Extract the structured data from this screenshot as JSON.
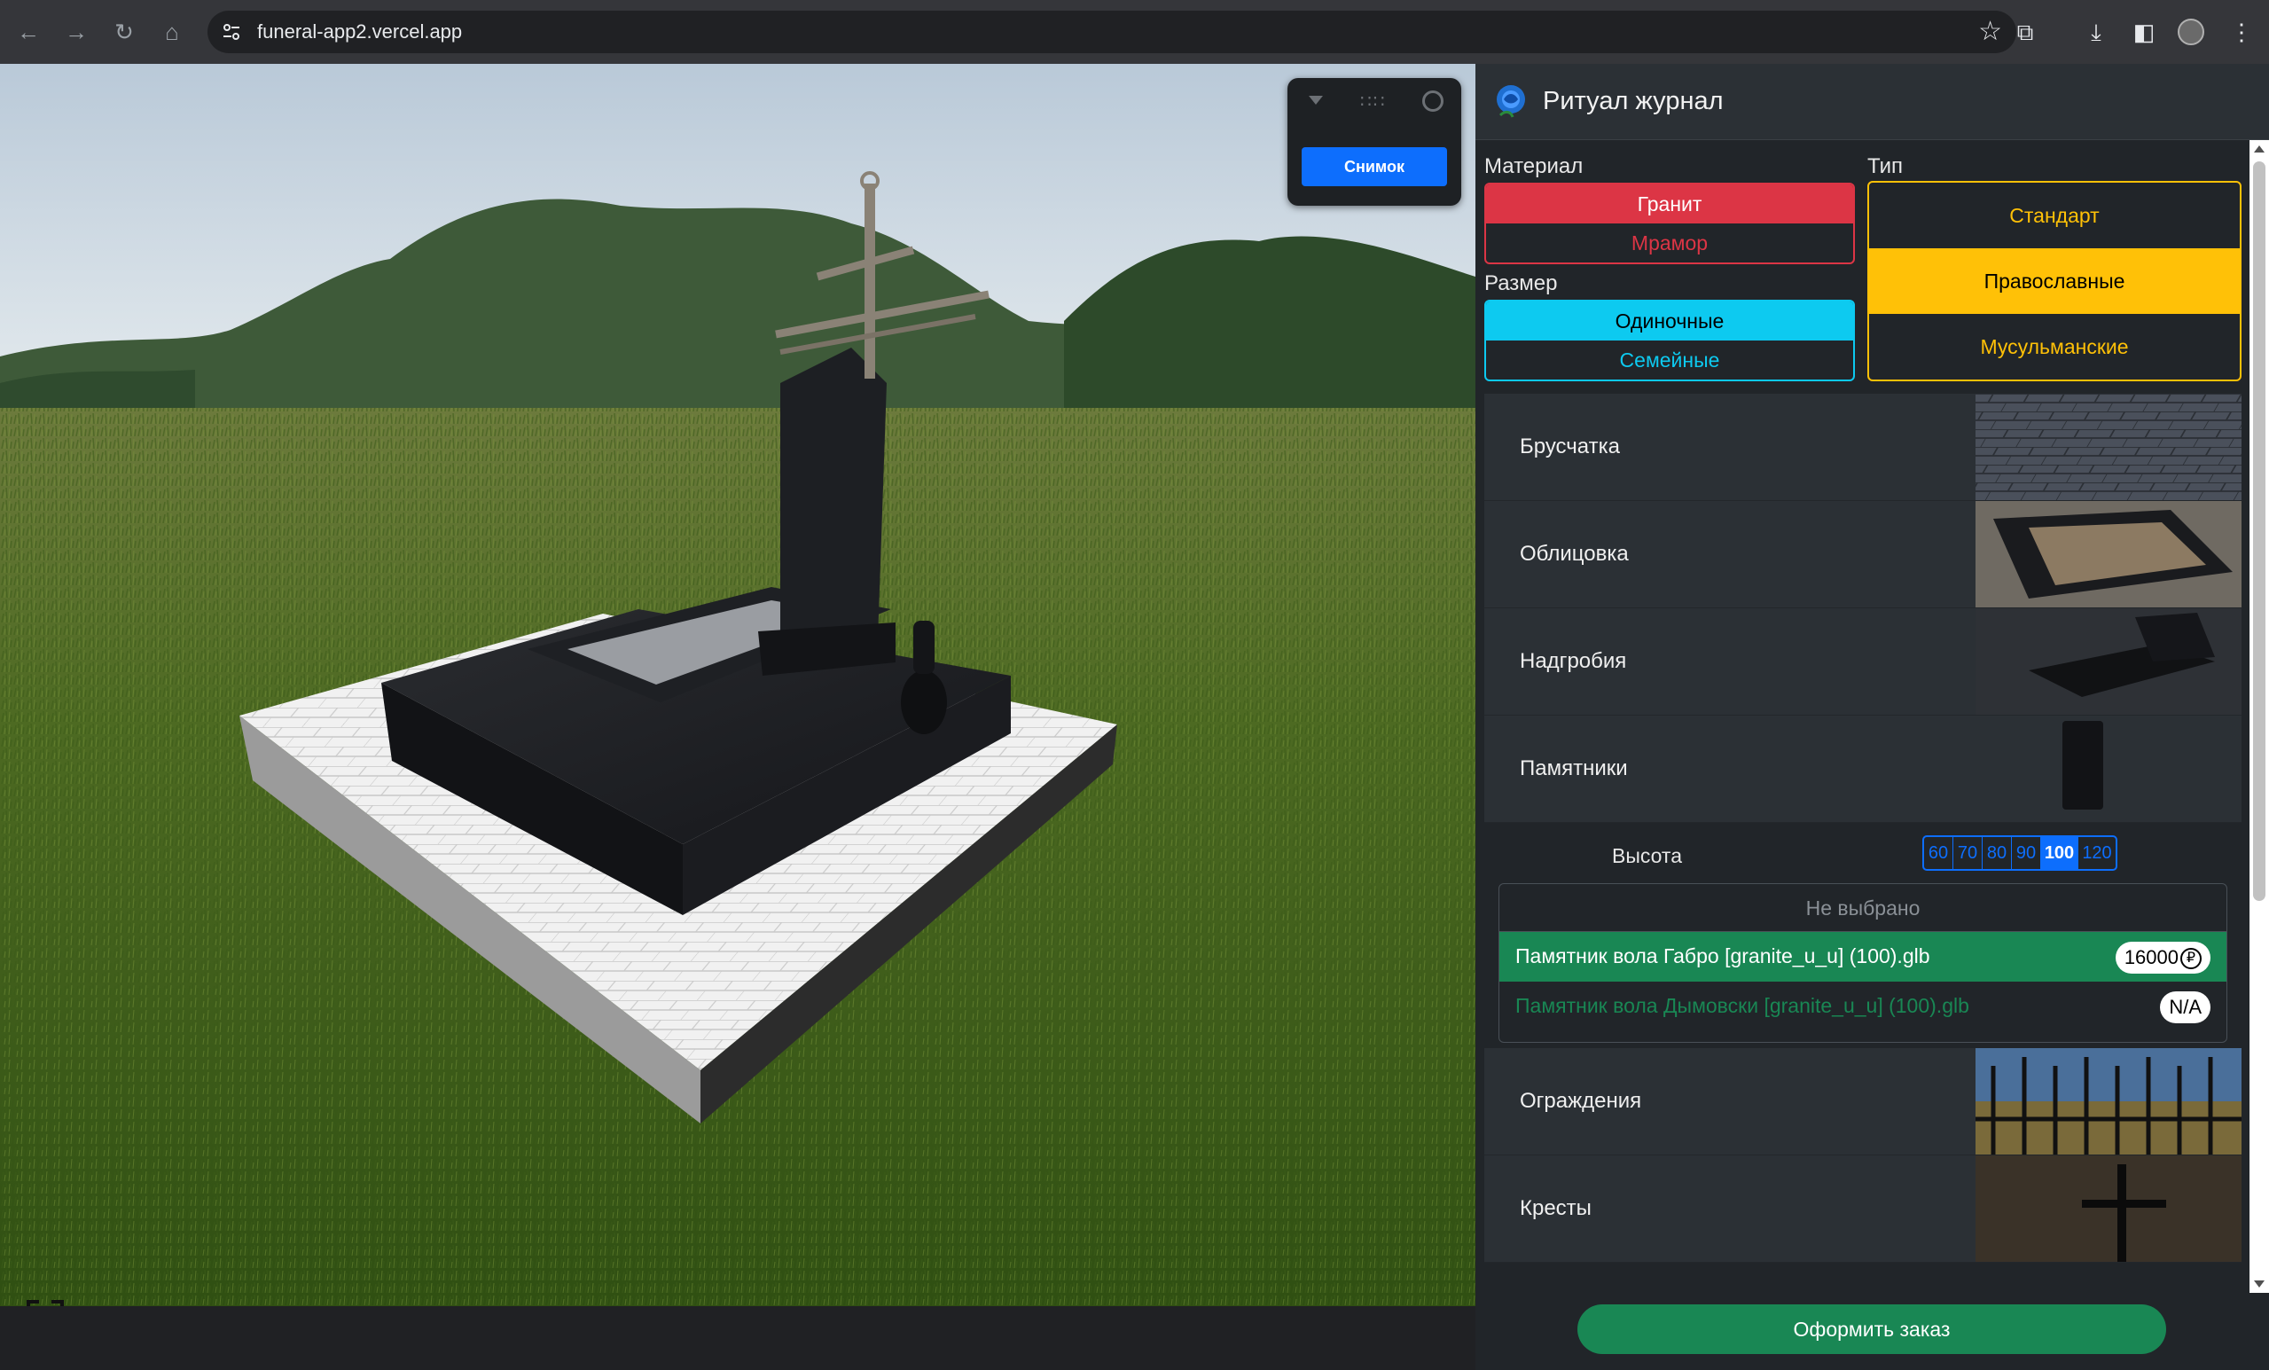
{
  "browser": {
    "url": "funeral-app2.vercel.app"
  },
  "scene": {
    "snapshot_label": "Снимок"
  },
  "panel": {
    "title": "Ритуал журнал",
    "material": {
      "label": "Материал",
      "options": [
        "Гранит",
        "Мрамор"
      ],
      "selected": "Гранит"
    },
    "size": {
      "label": "Размер",
      "options": [
        "Одиночные",
        "Семейные"
      ],
      "selected": "Одиночные"
    },
    "type": {
      "label": "Тип",
      "options": [
        "Стандарт",
        "Православные",
        "Мусульманские"
      ],
      "selected": "Православные"
    },
    "categories": [
      "Брусчатка",
      "Облицовка",
      "Надгробия",
      "Памятники",
      "Ограждения",
      "Кресты"
    ],
    "monuments": {
      "height_label": "Высота",
      "heights": [
        "60",
        "70",
        "80",
        "90",
        "100",
        "120"
      ],
      "selected_height": "100",
      "none_label": "Не выбрано",
      "items": [
        {
          "name": "Памятник вола Габро [granite_u_u] (100).glb",
          "price": "16000",
          "currency": "₽",
          "selected": true
        },
        {
          "name": "Памятник вола Дымовски [granite_u_u] (100).glb",
          "price": "N/A",
          "selected": false
        }
      ]
    },
    "order_button": "Оформить заказ"
  }
}
